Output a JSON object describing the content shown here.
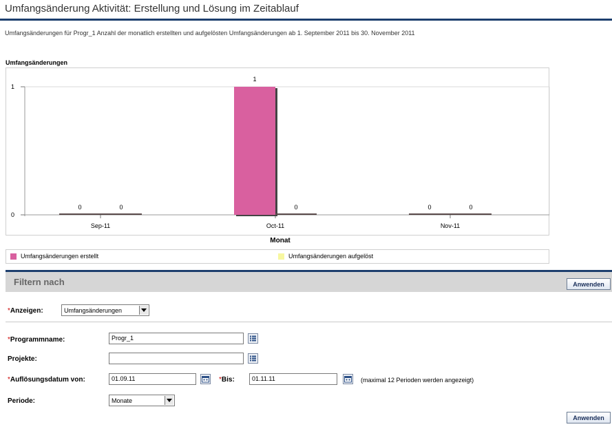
{
  "page": {
    "title": "Umfangsänderung Aktivität: Erstellung und Lösung im Zeitablauf",
    "subtitle": "Umfangsänderungen für Progr_1   Anzahl der monatlich erstellten und aufgelösten Umfangsänderungen ab 1. September 2011 bis 30. November 2011"
  },
  "chart": {
    "heading": "Umfangsänderungen",
    "legend": [
      "Umfangsänderungen erstellt",
      "Umfangsänderungen aufgelöst"
    ]
  },
  "chart_data": {
    "type": "bar",
    "categories": [
      "Sep-11",
      "Oct-11",
      "Nov-11"
    ],
    "series": [
      {
        "name": "Umfangsänderungen erstellt",
        "values": [
          0,
          1,
          0
        ],
        "color": "#d9609f"
      },
      {
        "name": "Umfangsänderungen aufgelöst",
        "values": [
          0,
          0,
          0
        ],
        "color": "#f7f7a0"
      }
    ],
    "data_labels": true,
    "xlabel": "Monat",
    "ylabel": "",
    "ylim": [
      0,
      1
    ],
    "yticks": [
      "0",
      "1"
    ],
    "grid": false,
    "legend_position": "bottom"
  },
  "filter": {
    "title": "Filtern nach",
    "apply_label": "Anwenden",
    "required_mark": "*",
    "show_label": "Anzeigen:",
    "show_value": "Umfangsänderungen",
    "program_label": "Programmname:",
    "program_value": "Progr_1",
    "projects_label": "Projekte:",
    "projects_value": "",
    "resolution_from_label": "Auflösungsdatum von:",
    "resolution_from_value": "01.09.11",
    "to_label": "Bis:",
    "to_value": "01.11.11",
    "periods_note": "(maximal 12 Perioden werden angezeigt)",
    "period_label": "Periode:",
    "period_value": "Monate"
  },
  "colors": {
    "rule": "#1d3f6e",
    "filter_bar": "#d6d6d6",
    "series_created": "#d9609f",
    "series_resolved": "#f7f7a0"
  }
}
